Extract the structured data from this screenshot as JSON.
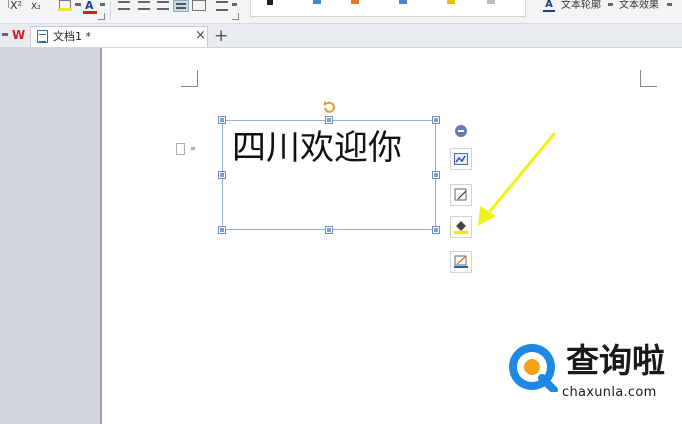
{
  "ribbon": {
    "superscript_label": "X²",
    "subscript_label": "X₂",
    "font_color_label": "A",
    "text_outline_label": "文本轮廓",
    "text_effect_label": "文本效果",
    "colors": {
      "highlight": "#f2e51b",
      "font_color": "#d02020"
    }
  },
  "tabbar": {
    "tab_label": "文档1 *",
    "close_symbol": "×",
    "new_tab_symbol": "+"
  },
  "canvas": {
    "textbox_text": "四川欢迎你"
  },
  "float_tools": {
    "icons": [
      "collapse-icon",
      "layout-options-icon",
      "shape-style-icon",
      "fill-icon",
      "outline-icon"
    ]
  },
  "watermark": {
    "site_name": "查询啦",
    "domain": "chaxunla.com"
  }
}
